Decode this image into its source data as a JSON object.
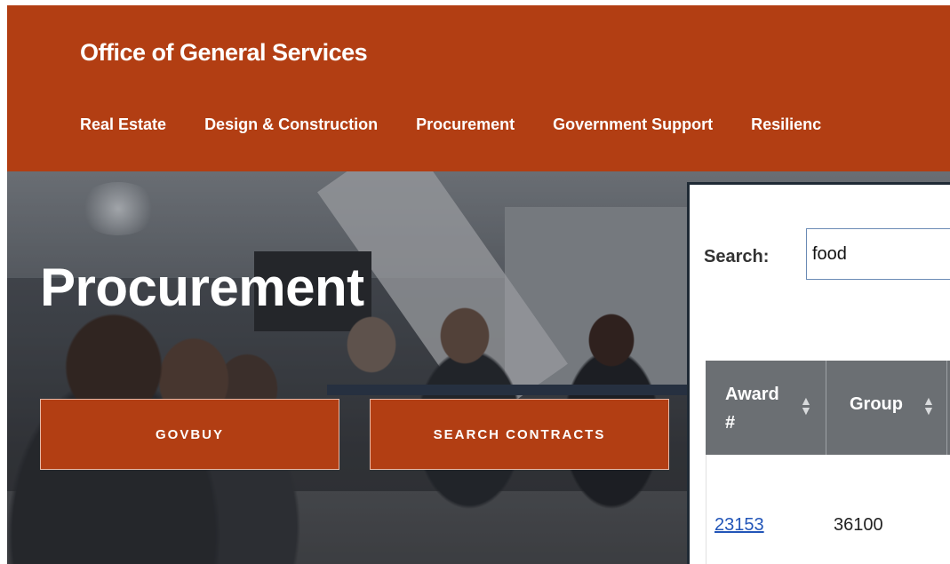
{
  "header": {
    "site_title": "Office of General Services",
    "brand_color": "#b23e13",
    "nav": [
      {
        "label": "Real Estate"
      },
      {
        "label": "Design & Construction"
      },
      {
        "label": "Procurement"
      },
      {
        "label": "Government Support"
      },
      {
        "label": "Resilienc"
      }
    ]
  },
  "hero": {
    "title": "Procurement",
    "buttons": [
      {
        "label": "GOVBUY"
      },
      {
        "label": "SEARCH CONTRACTS"
      }
    ]
  },
  "inset": {
    "search": {
      "label": "Search:",
      "value": "food"
    },
    "table": {
      "columns": [
        {
          "label": "Award #"
        },
        {
          "label": "Group"
        }
      ],
      "rows": [
        {
          "award": "23153",
          "group": "36100"
        }
      ]
    }
  }
}
